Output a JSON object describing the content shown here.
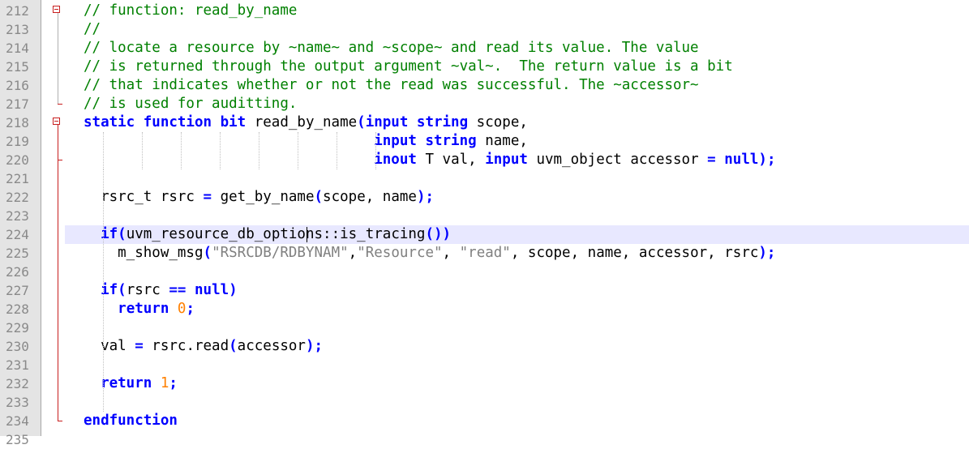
{
  "editor": {
    "lines": [
      {
        "num": "212",
        "segments": [
          {
            "t": "// function: read_by_name",
            "c": "c"
          }
        ]
      },
      {
        "num": "213",
        "segments": [
          {
            "t": "//",
            "c": "c"
          }
        ]
      },
      {
        "num": "214",
        "segments": [
          {
            "t": "// locate a resource by ~name~ and ~scope~ and read its value. The value",
            "c": "c"
          }
        ]
      },
      {
        "num": "215",
        "segments": [
          {
            "t": "// is returned through the output argument ~val~.  The return value is a bit",
            "c": "c"
          }
        ]
      },
      {
        "num": "216",
        "segments": [
          {
            "t": "// that indicates whether or not the read was successful. The ~accessor~",
            "c": "c"
          }
        ]
      },
      {
        "num": "217",
        "segments": [
          {
            "t": "// is used for auditting.",
            "c": "c"
          }
        ]
      },
      {
        "num": "218",
        "segments": [
          {
            "t": "static function bit",
            "c": "k"
          },
          {
            "t": " read_by_name",
            "c": "p"
          },
          {
            "t": "(",
            "c": "k"
          },
          {
            "t": "input string",
            "c": "k"
          },
          {
            "t": " scope,",
            "c": "p"
          }
        ]
      },
      {
        "num": "219",
        "segments": [
          {
            "t": "                                  ",
            "c": "p"
          },
          {
            "t": "input string",
            "c": "k"
          },
          {
            "t": " name,",
            "c": "p"
          }
        ]
      },
      {
        "num": "220",
        "segments": [
          {
            "t": "                                  ",
            "c": "p"
          },
          {
            "t": "inout",
            "c": "k"
          },
          {
            "t": " T val, ",
            "c": "p"
          },
          {
            "t": "input",
            "c": "k"
          },
          {
            "t": " uvm_object accessor ",
            "c": "p"
          },
          {
            "t": "=",
            "c": "k"
          },
          {
            "t": " ",
            "c": "p"
          },
          {
            "t": "null",
            "c": "k"
          },
          {
            "t": ");",
            "c": "k"
          }
        ]
      },
      {
        "num": "221",
        "segments": []
      },
      {
        "num": "222",
        "segments": [
          {
            "t": "  rsrc_t rsrc ",
            "c": "p"
          },
          {
            "t": "=",
            "c": "k"
          },
          {
            "t": " get_by_name",
            "c": "p"
          },
          {
            "t": "(",
            "c": "k"
          },
          {
            "t": "scope, name",
            "c": "p"
          },
          {
            "t": ");",
            "c": "k"
          }
        ]
      },
      {
        "num": "223",
        "segments": []
      },
      {
        "num": "224",
        "segments": [
          {
            "t": "  ",
            "c": "p"
          },
          {
            "t": "if",
            "c": "k"
          },
          {
            "t": "(",
            "c": "k"
          },
          {
            "t": "uvm_resource_db_options::is_tracing",
            "c": "p"
          },
          {
            "t": "())",
            "c": "k"
          }
        ]
      },
      {
        "num": "225",
        "segments": [
          {
            "t": "    m_show_msg",
            "c": "p"
          },
          {
            "t": "(",
            "c": "k"
          },
          {
            "t": "\"RSRCDB/RDBYNAM\"",
            "c": "s"
          },
          {
            "t": ",",
            "c": "p"
          },
          {
            "t": "\"Resource\"",
            "c": "s"
          },
          {
            "t": ", ",
            "c": "p"
          },
          {
            "t": "\"read\"",
            "c": "s"
          },
          {
            "t": ", scope, name, accessor, rsrc",
            "c": "p"
          },
          {
            "t": ");",
            "c": "k"
          }
        ]
      },
      {
        "num": "226",
        "segments": []
      },
      {
        "num": "227",
        "segments": [
          {
            "t": "  ",
            "c": "p"
          },
          {
            "t": "if",
            "c": "k"
          },
          {
            "t": "(",
            "c": "k"
          },
          {
            "t": "rsrc ",
            "c": "p"
          },
          {
            "t": "==",
            "c": "k"
          },
          {
            "t": " ",
            "c": "p"
          },
          {
            "t": "null)",
            "c": "k"
          }
        ]
      },
      {
        "num": "228",
        "segments": [
          {
            "t": "    ",
            "c": "p"
          },
          {
            "t": "return",
            "c": "k"
          },
          {
            "t": " ",
            "c": "p"
          },
          {
            "t": "0",
            "c": "n"
          },
          {
            "t": ";",
            "c": "k"
          }
        ]
      },
      {
        "num": "229",
        "segments": []
      },
      {
        "num": "230",
        "segments": [
          {
            "t": "  val ",
            "c": "p"
          },
          {
            "t": "=",
            "c": "k"
          },
          {
            "t": " rsrc.read",
            "c": "p"
          },
          {
            "t": "(",
            "c": "k"
          },
          {
            "t": "accessor",
            "c": "p"
          },
          {
            "t": ");",
            "c": "k"
          }
        ]
      },
      {
        "num": "231",
        "segments": []
      },
      {
        "num": "232",
        "segments": [
          {
            "t": "  ",
            "c": "p"
          },
          {
            "t": "return",
            "c": "k"
          },
          {
            "t": " ",
            "c": "p"
          },
          {
            "t": "1",
            "c": "n"
          },
          {
            "t": ";",
            "c": "k"
          }
        ]
      },
      {
        "num": "233",
        "segments": []
      },
      {
        "num": "234",
        "segments": [
          {
            "t": "endfunction",
            "c": "k"
          }
        ]
      },
      {
        "num": "235",
        "segments": []
      }
    ],
    "current_line": "224",
    "colors": {
      "comment": "#008000",
      "keyword": "#0000ff",
      "string": "#808080",
      "number": "#ff8000",
      "gutter_bg": "#e4e4e4",
      "fold_marker": "#c81f1f",
      "current_line_bg": "#e8e8ff"
    }
  }
}
